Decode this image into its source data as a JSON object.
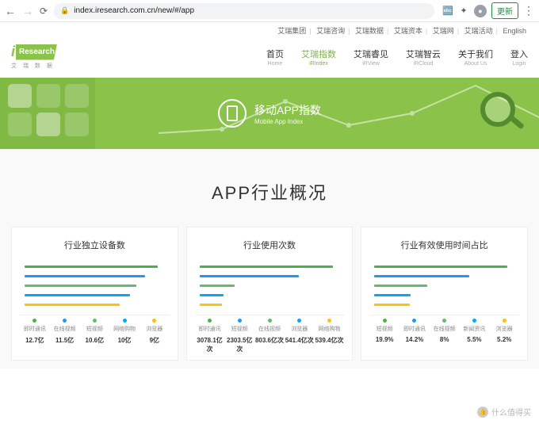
{
  "browser": {
    "url": "index.iresearch.com.cn/new/#/app",
    "update": "更新"
  },
  "top_links": [
    "艾瑞集团",
    "艾瑞咨询",
    "艾瑞数据",
    "艾瑞资本",
    "艾瑞网",
    "艾瑞活动",
    "English"
  ],
  "logo": {
    "brand": "Research",
    "sub": "艾 瑞 数 据"
  },
  "nav": [
    {
      "cn": "首页",
      "en": "Home"
    },
    {
      "cn": "艾瑞指数",
      "en": "iRIndex"
    },
    {
      "cn": "艾瑞睿见",
      "en": "iRView"
    },
    {
      "cn": "艾瑞智云",
      "en": "iRCloud"
    },
    {
      "cn": "关于我们",
      "en": "About Us"
    },
    {
      "cn": "登入",
      "en": "Login"
    }
  ],
  "banner": {
    "title_cn": "移动APP指数",
    "title_en": "Mobile App Index"
  },
  "section_title": "APP行业概况",
  "chart_data": [
    {
      "type": "bar",
      "title": "行业独立设备数",
      "categories": [
        "即时通讯",
        "在线视频",
        "短视频",
        "网络购物",
        "浏览器"
      ],
      "values": [
        "12.7亿",
        "11.5亿",
        "10.6亿",
        "10亿",
        "9亿"
      ],
      "bar_pct": [
        95,
        86,
        80,
        75,
        68
      ],
      "colors": [
        "#4caf50",
        "#2196f3",
        "#66bb6a",
        "#03a9f4",
        "#ffc107"
      ]
    },
    {
      "type": "bar",
      "title": "行业使用次数",
      "categories": [
        "即时通讯",
        "短视频",
        "在线视频",
        "浏览器",
        "网络购物"
      ],
      "values": [
        "3078.1亿次",
        "2303.5亿次",
        "803.6亿次",
        "541.4亿次",
        "539.4亿次"
      ],
      "bar_pct": [
        95,
        71,
        25,
        17,
        16
      ],
      "colors": [
        "#4caf50",
        "#2196f3",
        "#66bb6a",
        "#03a9f4",
        "#ffc107"
      ]
    },
    {
      "type": "bar",
      "title": "行业有效使用时间占比",
      "categories": [
        "短视频",
        "即时通讯",
        "在线视频",
        "新闻资讯",
        "浏览器"
      ],
      "values": [
        "19.9%",
        "14.2%",
        "8%",
        "5.5%",
        "5.2%"
      ],
      "bar_pct": [
        95,
        68,
        38,
        26,
        25
      ],
      "colors": [
        "#4caf50",
        "#2196f3",
        "#66bb6a",
        "#03a9f4",
        "#ffc107"
      ]
    }
  ],
  "watermark": "什么值得买"
}
